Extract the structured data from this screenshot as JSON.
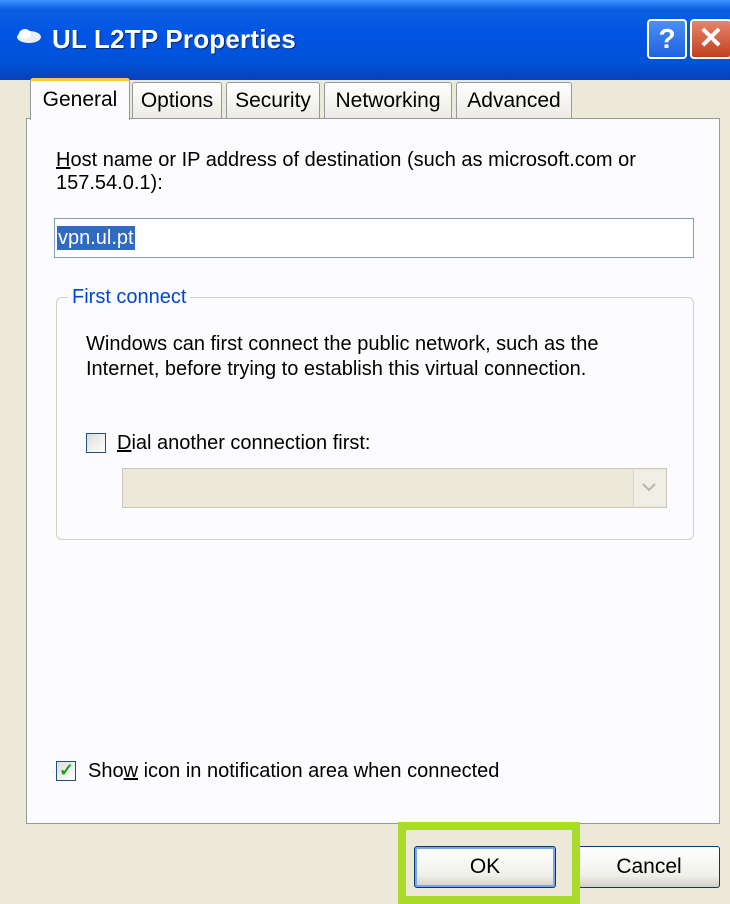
{
  "window": {
    "title": "UL L2TP Properties",
    "help_label": "?",
    "close_label": "✕"
  },
  "tabs": [
    {
      "label": "General",
      "active": true
    },
    {
      "label": "Options",
      "active": false
    },
    {
      "label": "Security",
      "active": false
    },
    {
      "label": "Networking",
      "active": false
    },
    {
      "label": "Advanced",
      "active": false
    }
  ],
  "general": {
    "host_label_mnemonic": "H",
    "host_label_rest": "ost name or IP address of destination (such as microsoft.com or",
    "host_label_line2": "157.54.0.1):",
    "host_value": "vpn.ul.pt",
    "first_connect": {
      "title": "First connect",
      "description_line1": "Windows can first connect the public network, such as the",
      "description_line2": "Internet, before trying to establish this virtual connection.",
      "dial_checkbox_mnemonic": "D",
      "dial_checkbox_rest": "ial another connection first:",
      "dial_checked": false,
      "dial_select_value": ""
    },
    "show_icon_pre": "Sho",
    "show_icon_mnemonic": "w",
    "show_icon_rest": " icon in notification area when connected",
    "show_icon_checked": true
  },
  "buttons": {
    "ok": "OK",
    "cancel": "Cancel"
  },
  "colors": {
    "titlebar": "#0054e3",
    "highlight": "#a8dc28",
    "group_title": "#0046d5"
  }
}
